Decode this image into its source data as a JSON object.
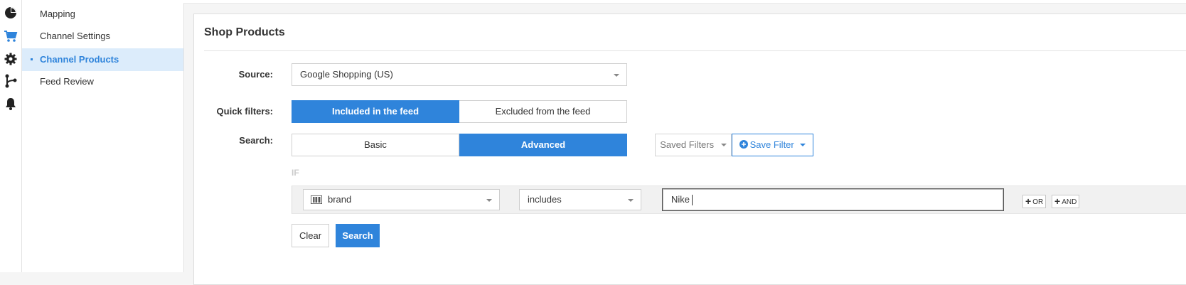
{
  "rail": {
    "icons": [
      "pie-chart-icon",
      "shopping-cart-icon",
      "gear-icon",
      "flow-branch-icon",
      "bell-icon"
    ],
    "active_color": "#2f84db"
  },
  "sidebar": {
    "items": [
      {
        "label": "Mapping",
        "active": false
      },
      {
        "label": "Channel Settings",
        "active": false
      },
      {
        "label": "Channel Products",
        "active": true
      },
      {
        "label": "Feed Review",
        "active": false
      }
    ]
  },
  "panel": {
    "title": "Shop Products",
    "source": {
      "label": "Source:",
      "value": "Google Shopping (US)"
    },
    "quick_filters": {
      "label": "Quick filters:",
      "options": [
        {
          "label": "Included in the feed",
          "selected": true
        },
        {
          "label": "Excluded from the feed",
          "selected": false
        }
      ]
    },
    "search": {
      "label": "Search:",
      "modes": [
        {
          "label": "Basic",
          "selected": false
        },
        {
          "label": "Advanced",
          "selected": true
        }
      ],
      "saved_filters_label": "Saved Filters",
      "save_filter_label": "Save Filter"
    },
    "rule": {
      "if_label": "IF",
      "field": "brand",
      "operator": "includes",
      "value": "Nike",
      "or_label": "OR",
      "and_label": "AND"
    },
    "actions": {
      "clear_label": "Clear",
      "search_label": "Search"
    }
  },
  "colors": {
    "accent": "#2f84db",
    "active_bg": "#dcecfb"
  }
}
